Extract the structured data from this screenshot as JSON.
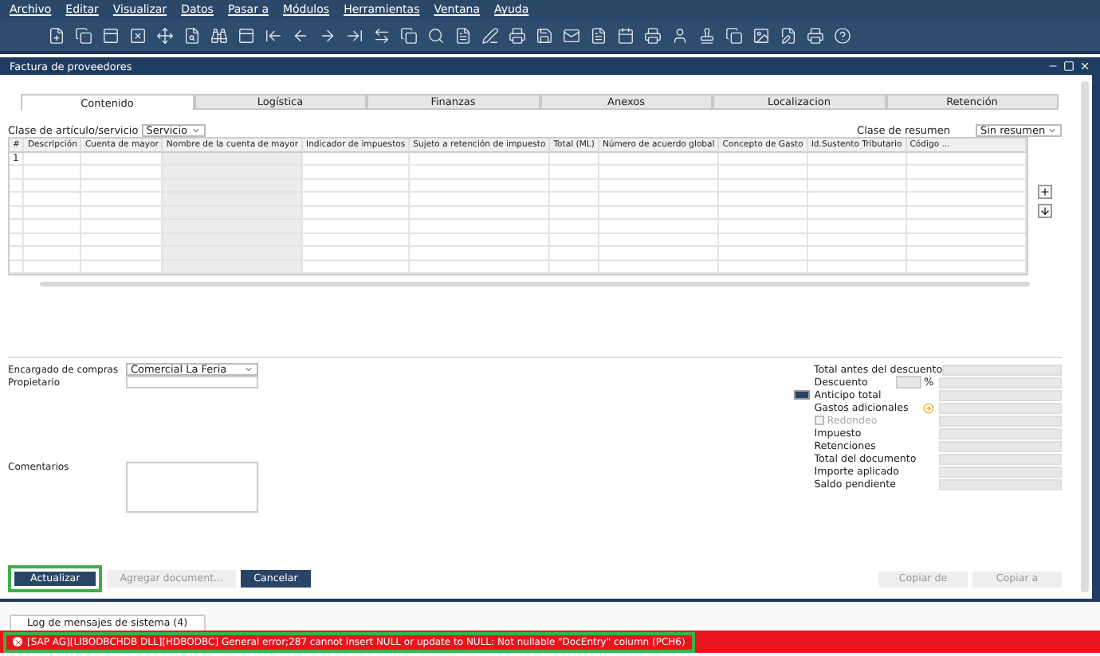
{
  "menu": [
    "Archivo",
    "Editar",
    "Visualizar",
    "Datos",
    "Pasar a",
    "Módulos",
    "Herramientas",
    "Ventana",
    "Ayuda"
  ],
  "window": {
    "title": "Factura de proveedores"
  },
  "tabs": [
    {
      "label": "Contenido",
      "selected": true
    },
    {
      "label": "Logística",
      "selected": false
    },
    {
      "label": "Finanzas",
      "selected": false
    },
    {
      "label": "Anexos",
      "selected": false
    },
    {
      "label": "Localizacion",
      "selected": false
    },
    {
      "label": "Retención",
      "selected": false
    }
  ],
  "item_class": {
    "label": "Clase de artículo/servicio",
    "value": "Servicio"
  },
  "summary_class": {
    "label": "Clase de resumen",
    "value": "Sin resumen"
  },
  "table": {
    "columns": [
      "#",
      "Descripción",
      "Cuenta de mayor",
      "Nombre de la cuenta de mayor",
      "Indicador de impuestos",
      "Sujeto a retención de impuesto",
      "Total (ML)",
      "Número de acuerdo global",
      "Concepto de Gasto",
      "Id.Sustento Tributario",
      "Código ..."
    ],
    "rows": [
      {
        "number": "1"
      }
    ]
  },
  "buyer": {
    "label": "Encargado de compras",
    "value": "Comercial La Feria"
  },
  "owner": {
    "label": "Propietario"
  },
  "comments": {
    "label": "Comentarios"
  },
  "totals": [
    {
      "label": "Total antes del descuento",
      "kind": "field"
    },
    {
      "label": "Descuento",
      "kind": "discount",
      "unit": "%"
    },
    {
      "label": "Anticipo total",
      "kind": "advance"
    },
    {
      "label": "Gastos adicionales",
      "kind": "freight"
    },
    {
      "label": "Redondeo",
      "kind": "checkbox",
      "checked": false
    },
    {
      "label": "Impuesto",
      "kind": "field"
    },
    {
      "label": "Retenciones",
      "kind": "field"
    },
    {
      "label": "Total del documento",
      "kind": "field"
    },
    {
      "label": "Importe aplicado",
      "kind": "field"
    },
    {
      "label": "Saldo pendiente",
      "kind": "field"
    }
  ],
  "buttons": [
    {
      "label": "Actualizar",
      "disabled": false,
      "highlighted": true
    },
    {
      "label": "Agregar document...",
      "disabled": true,
      "highlighted": false
    },
    {
      "label": "Cancelar",
      "disabled": false,
      "highlighted": false
    }
  ],
  "copy_buttons": [
    {
      "label": "Copiar de",
      "disabled": true
    },
    {
      "label": "Copiar a",
      "disabled": true
    }
  ],
  "log_tab": {
    "label": "Log de mensajes de sistema (4)"
  },
  "status": {
    "message": "[SAP AG][LIBODBCHDB DLL][HDBODBC] General error;287 cannot insert NULL or update to NULL: Not nullable \"DocEntry\" column  (PCH6)",
    "highlighted": true
  }
}
